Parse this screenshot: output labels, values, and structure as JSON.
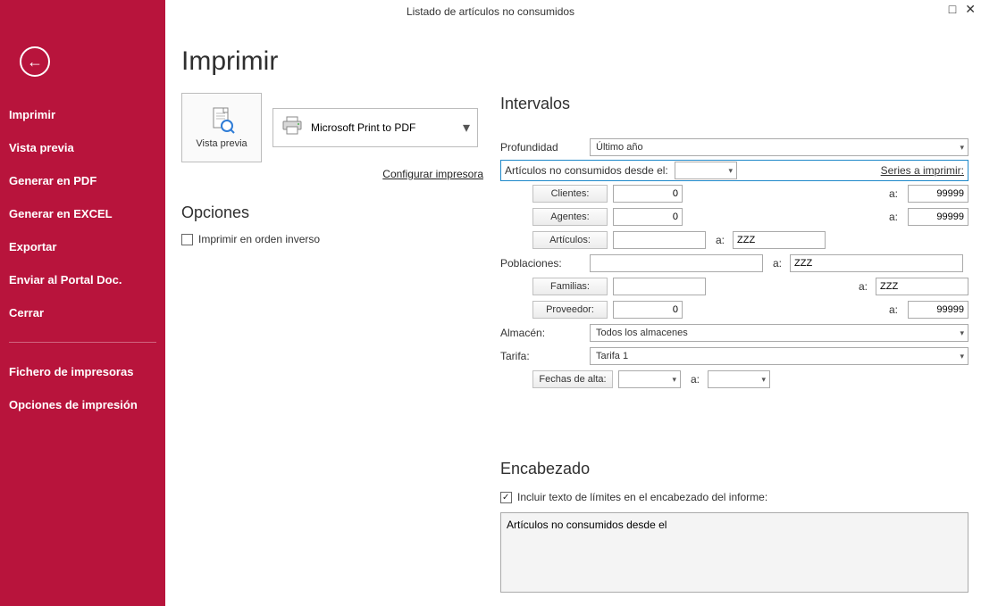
{
  "window": {
    "title": "Listado de artículos no consumidos"
  },
  "sidebar": {
    "items": [
      "Imprimir",
      "Vista previa",
      "Generar en PDF",
      "Generar en EXCEL",
      "Exportar",
      "Enviar al Portal Doc.",
      "Cerrar"
    ],
    "items2": [
      "Fichero de impresoras",
      "Opciones de impresión"
    ]
  },
  "main": {
    "title": "Imprimir",
    "preview_label": "Vista previa",
    "printer_name": "Microsoft Print to PDF",
    "configure_printer": "Configurar impresora",
    "options_title": "Opciones",
    "reverse_label": "Imprimir en orden inverso"
  },
  "intervalos": {
    "title": "Intervalos",
    "profundidad_label": "Profundidad",
    "profundidad_value": "Último año",
    "no_consumidos_label": "Artículos no consumidos desde el:",
    "series_link": "Series a imprimir:",
    "no_consumidos_value": "",
    "rows": {
      "clientes": {
        "label": "Clientes:",
        "from": "0",
        "to": "99999"
      },
      "agentes": {
        "label": "Agentes:",
        "from": "0",
        "to": "99999"
      },
      "articulos": {
        "label": "Artículos:",
        "from": "",
        "to": "ZZZ"
      },
      "poblaciones": {
        "label": "Poblaciones:",
        "from": "",
        "to": "ZZZ"
      },
      "familias": {
        "label": "Familias:",
        "from": "",
        "to": "ZZZ"
      },
      "proveedor": {
        "label": "Proveedor:",
        "from": "0",
        "to": "99999"
      }
    },
    "a": "a:",
    "almacen_label": "Almacén:",
    "almacen_value": "Todos los almacenes",
    "tarifa_label": "Tarifa:",
    "tarifa_value": "Tarifa 1",
    "fechas_label": "Fechas de alta:",
    "fechas_from": "",
    "fechas_to": ""
  },
  "encabezado": {
    "title": "Encabezado",
    "check_label": "Incluir texto de límites en el encabezado del informe:",
    "text": "Artículos no consumidos desde el"
  }
}
